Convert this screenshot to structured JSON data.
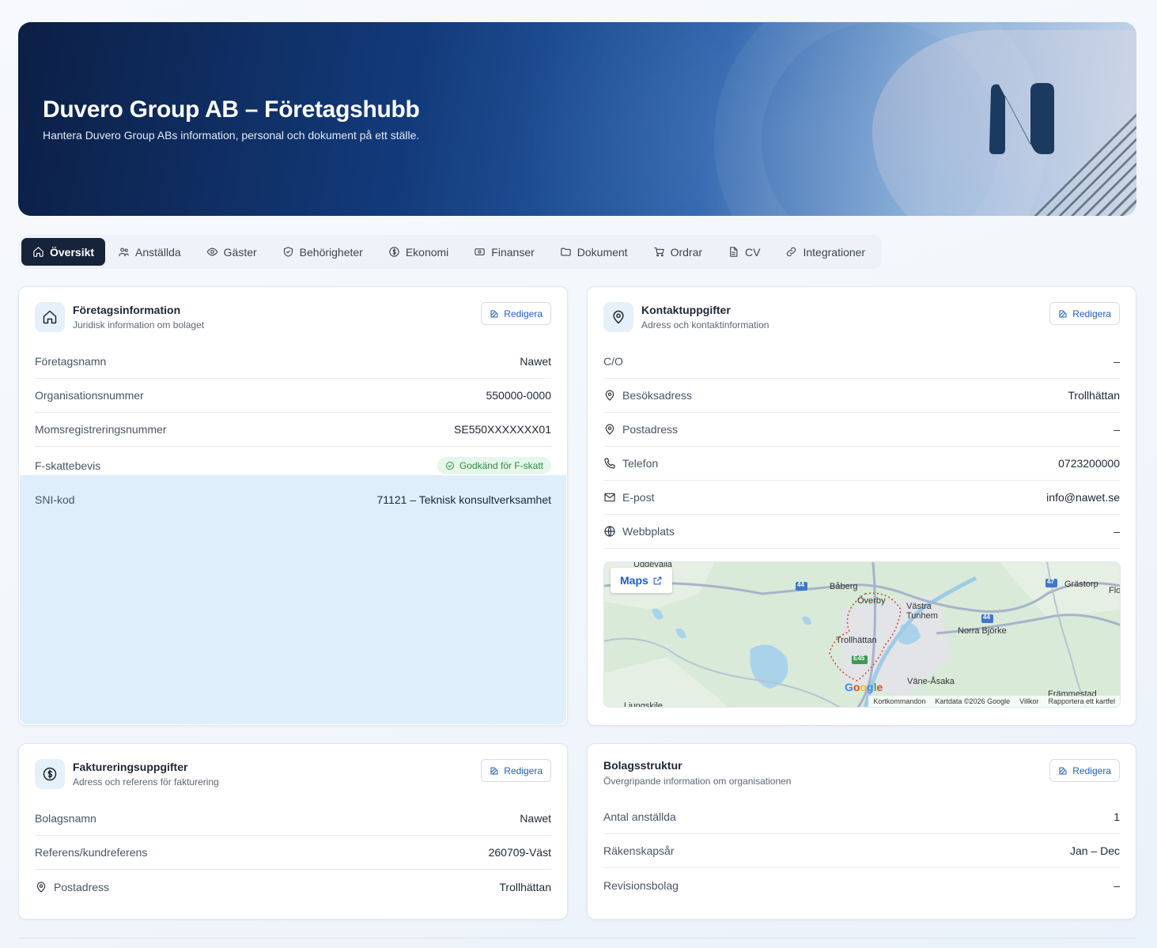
{
  "hero": {
    "title": "Duvero Group AB – Företagshubb",
    "subtitle": "Hantera Duvero Group ABs information, personal och dokument på ett ställe.",
    "logo_icon": "n-logo"
  },
  "tabs": [
    {
      "label": "Översikt",
      "icon": "home-icon",
      "active": true
    },
    {
      "label": "Anställda",
      "icon": "users-icon"
    },
    {
      "label": "Gäster",
      "icon": "eye-icon"
    },
    {
      "label": "Behörigheter",
      "icon": "shield-icon"
    },
    {
      "label": "Ekonomi",
      "icon": "dollar-circle-icon"
    },
    {
      "label": "Finanser",
      "icon": "banknote-icon"
    },
    {
      "label": "Dokument",
      "icon": "folder-icon"
    },
    {
      "label": "Ordrar",
      "icon": "cart-icon"
    },
    {
      "label": "CV",
      "icon": "file-icon"
    },
    {
      "label": "Integrationer",
      "icon": "link-icon"
    }
  ],
  "edit_label": "Redigera",
  "company": {
    "title": "Företagsinformation",
    "subtitle": "Juridisk information om bolaget",
    "rows": [
      {
        "label": "Företagsnamn",
        "value": "Nawet"
      },
      {
        "label": "Organisationsnummer",
        "value": "550000-0000"
      },
      {
        "label": "Momsregistreringsnummer",
        "value": "SE550XXXXXXX01"
      },
      {
        "label": "F-skattebevis",
        "badge": "Godkänd för F-skatt"
      },
      {
        "label": "SNI-kod",
        "value": "71121 – Teknisk konsultverksamhet"
      }
    ]
  },
  "contact": {
    "title": "Kontaktuppgifter",
    "subtitle": "Adress och kontaktinformation",
    "rows": [
      {
        "label": "C/O",
        "value": "–"
      },
      {
        "label": "Besöksadress",
        "value": "Trollhättan",
        "icon": "pin-icon"
      },
      {
        "label": "Postadress",
        "value": "–",
        "icon": "pin-icon"
      },
      {
        "label": "Telefon",
        "value": "0723200000",
        "icon": "phone-icon"
      },
      {
        "label": "E-post",
        "value": "info@nawet.se",
        "icon": "mail-icon"
      },
      {
        "label": "Webbplats",
        "value": "–",
        "icon": "globe-icon"
      }
    ],
    "map": {
      "button": "Maps",
      "google": "Google",
      "footer": [
        "Kortkommandon",
        "Kartdata ©2026 Google",
        "Villkor",
        "Rapportera ett kartfel"
      ],
      "places": [
        "Uddevalla",
        "Båberg",
        "Överby",
        "Västra Tunhem",
        "Norra Björke",
        "Grästorp",
        "Trollhättan",
        "Väne-Åsaka",
        "Främmestad",
        "Ljungskile",
        "Flo"
      ],
      "road_labels": [
        "44",
        "44",
        "47",
        "E45"
      ]
    }
  },
  "billing": {
    "title": "Faktureringsuppgifter",
    "subtitle": "Adress och referens för fakturering",
    "rows": [
      {
        "label": "Bolagsnamn",
        "value": "Nawet"
      },
      {
        "label": "Referens/kundreferens",
        "value": "260709-Väst"
      },
      {
        "label": "Postadress",
        "value": "Trollhättan",
        "icon": "pin-icon"
      }
    ]
  },
  "structure": {
    "title": "Bolagsstruktur",
    "subtitle": "Övergripande information om organisationen",
    "rows": [
      {
        "label": "Antal anställda",
        "value": "1"
      },
      {
        "label": "Räkenskapsår",
        "value": "Jan – Dec"
      },
      {
        "label": "Revisionsbolag",
        "value": "–"
      }
    ]
  },
  "colors": {
    "accent": "#1f5fbf",
    "dark": "#17233a",
    "success": "#2f8a47",
    "highlight": "#dfeefb"
  }
}
